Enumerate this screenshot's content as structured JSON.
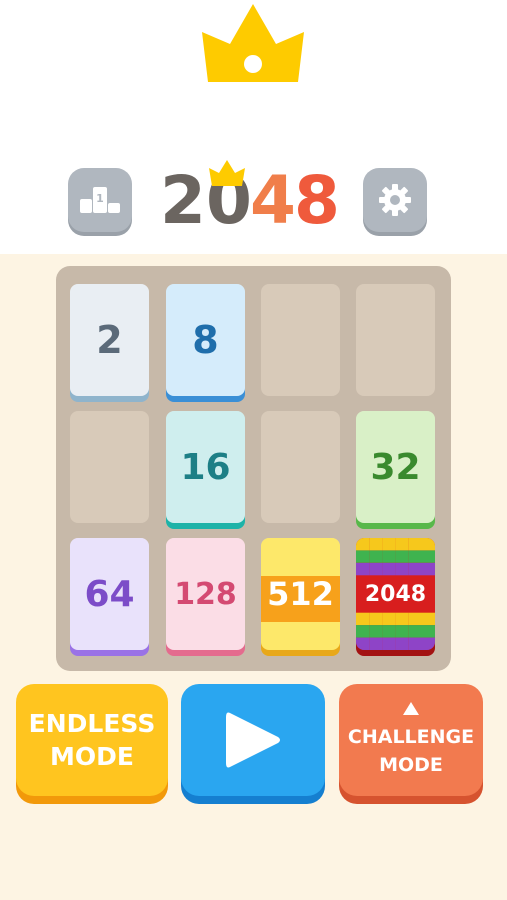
{
  "header": {
    "logo": {
      "digits": [
        "2",
        "0",
        "4",
        "8"
      ],
      "colors": [
        "#6b6560",
        "#6b6560",
        "#f07e4a",
        "#ef5a3c"
      ]
    },
    "icons": {
      "top": "crown-icon",
      "left": "podium-icon",
      "right": "gear-icon"
    }
  },
  "board": {
    "tiles": [
      {
        "value": "2",
        "row": 0,
        "col": 0,
        "style": "t2"
      },
      {
        "value": "8",
        "row": 0,
        "col": 1,
        "style": "t8"
      },
      {
        "value": "16",
        "row": 1,
        "col": 1,
        "style": "t16"
      },
      {
        "value": "32",
        "row": 1,
        "col": 3,
        "style": "t32"
      },
      {
        "value": "64",
        "row": 2,
        "col": 0,
        "style": "t64"
      },
      {
        "value": "128",
        "row": 2,
        "col": 1,
        "style": "t128"
      },
      {
        "value": "512",
        "row": 2,
        "col": 2,
        "style": "t512"
      },
      {
        "value": "2048",
        "row": 2,
        "col": 3,
        "style": "t2048"
      }
    ]
  },
  "modes": {
    "endless": {
      "line1": "ENDLESS",
      "line2": "MODE"
    },
    "play": {
      "icon": "play-icon"
    },
    "challenge": {
      "line1": "CHALLENGE",
      "line2": "MODE",
      "icon": "triangle-up-icon"
    }
  },
  "colors": {
    "background": "#fdf4e3",
    "board": "#c7b9a9",
    "crown": "#fecb00",
    "endless": "#ffc51f",
    "play": "#2aa6f0",
    "challenge": "#f27a4f"
  }
}
